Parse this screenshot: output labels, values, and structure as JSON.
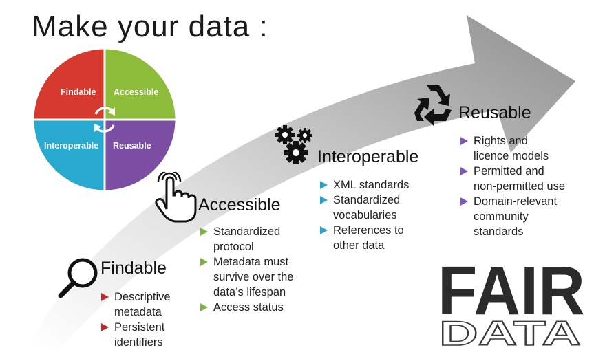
{
  "title": "Make your data :",
  "wheel": {
    "quadrants": [
      {
        "label": "Findable",
        "color": "#d63a2f"
      },
      {
        "label": "Accessible",
        "color": "#8dbb3a"
      },
      {
        "label": "Interoperable",
        "color": "#28a9cf"
      },
      {
        "label": "Reusable",
        "color": "#7b4ea3"
      }
    ]
  },
  "stages": {
    "findable": {
      "title": "Findable",
      "marker_color": "#c62828",
      "items": [
        [
          "Descriptive",
          "metadata"
        ],
        [
          "Persistent",
          "identifiers"
        ]
      ]
    },
    "accessible": {
      "title": "Accessible",
      "marker_color": "#7cb342",
      "items": [
        [
          "Standardized",
          "protocol"
        ],
        [
          "Metadata must",
          "survive over the",
          "data’s lifespan"
        ],
        [
          "Access status"
        ]
      ]
    },
    "interoperable": {
      "title": "Interoperable",
      "marker_color": "#29a3d1",
      "items": [
        [
          "XML standards"
        ],
        [
          "Standardized",
          "vocabularies"
        ],
        [
          "References to",
          "other data"
        ]
      ]
    },
    "reusable": {
      "title": "Reusable",
      "marker_color": "#7e57c2",
      "items": [
        [
          "Rights and",
          "licence models"
        ],
        [
          "Permitted and",
          "non-permitted use"
        ],
        [
          "Domain-relevant",
          "community",
          "standards"
        ]
      ]
    }
  },
  "logo": {
    "top": "FAIR",
    "bottom": "DATA"
  },
  "icons": {
    "findable": "magnifier-icon",
    "accessible": "hand-pointer-icon",
    "interoperable": "gears-icon",
    "reusable": "recycle-icon"
  }
}
